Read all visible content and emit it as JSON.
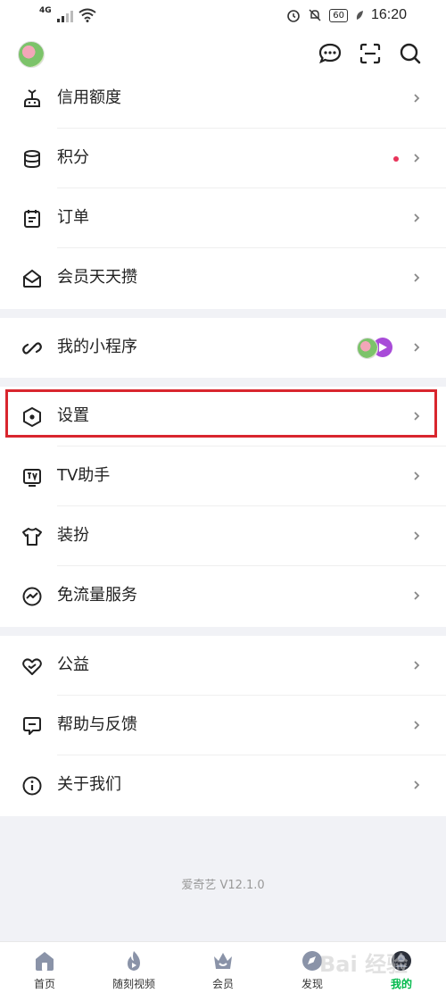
{
  "status_bar": {
    "network": "4G",
    "time": "16:20",
    "battery": "60"
  },
  "groups": [
    {
      "items": [
        {
          "icon": "credit-limit-icon",
          "label": "信用额度"
        },
        {
          "icon": "points-icon",
          "label": "积分"
        },
        {
          "icon": "order-icon",
          "label": "订单"
        },
        {
          "icon": "member-daily-icon",
          "label": "会员天天攒"
        }
      ]
    },
    {
      "items": [
        {
          "icon": "mini-program-icon",
          "label": "我的小程序"
        }
      ]
    },
    {
      "items": [
        {
          "icon": "settings-icon",
          "label": "设置"
        },
        {
          "icon": "tv-assistant-icon",
          "label": "TV助手"
        },
        {
          "icon": "dress-up-icon",
          "label": "装扮"
        },
        {
          "icon": "free-traffic-icon",
          "label": "免流量服务"
        }
      ]
    },
    {
      "items": [
        {
          "icon": "charity-icon",
          "label": "公益"
        },
        {
          "icon": "help-feedback-icon",
          "label": "帮助与反馈"
        },
        {
          "icon": "about-icon",
          "label": "关于我们"
        }
      ]
    }
  ],
  "version": "爱奇艺 V12.1.0",
  "tabs": [
    {
      "icon": "home-icon",
      "label": "首页",
      "active": false
    },
    {
      "icon": "flame-icon",
      "label": "随刻视频",
      "active": false
    },
    {
      "icon": "crown-icon",
      "label": "会员",
      "active": false
    },
    {
      "icon": "compass-icon",
      "label": "发现",
      "active": false
    },
    {
      "icon": "profile-icon",
      "label": "我的",
      "active": true
    }
  ],
  "watermark": "Bai 经验",
  "colors": {
    "accent": "#00b94b",
    "highlight": "#d9262e",
    "dot": "#e8345a"
  }
}
